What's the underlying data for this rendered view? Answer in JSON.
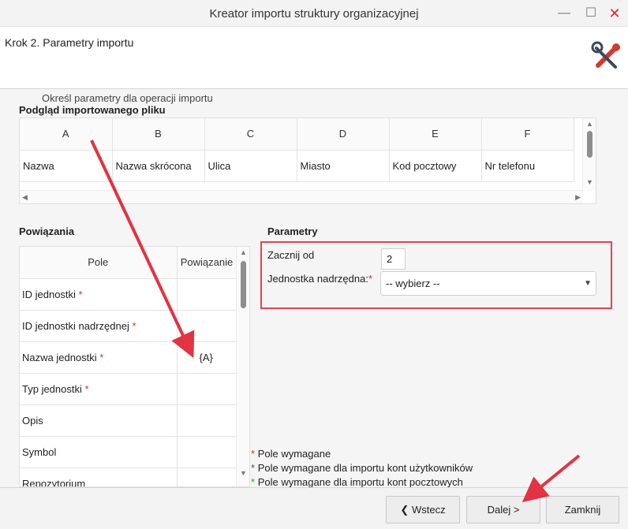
{
  "window": {
    "title": "Kreator importu struktury organizacyjnej",
    "min_glyph": "—",
    "max_glyph": "☐",
    "close_glyph": "✕"
  },
  "header": {
    "step_title": "Krok 2. Parametry importu",
    "icon": "tools-icon"
  },
  "content": {
    "subtitle": "Określ parametry dla operacji importu",
    "preview": {
      "title": "Podgląd importowanego pliku",
      "columns": [
        "A",
        "B",
        "C",
        "D",
        "E",
        "F"
      ],
      "row": [
        "Nazwa",
        "Nazwa skrócona",
        "Ulica",
        "Miasto",
        "Kod pocztowy",
        "Nr telefonu"
      ]
    },
    "mapping": {
      "title": "Powiązania",
      "headers": [
        "Pole",
        "Powiązanie"
      ],
      "rows": [
        {
          "field": "ID jednostki",
          "required": "*",
          "link": ""
        },
        {
          "field": "ID jednostki nadrzędnej",
          "required": "*",
          "link": ""
        },
        {
          "field": "Nazwa jednostki",
          "required": "*",
          "link": "{A}"
        },
        {
          "field": "Typ jednostki",
          "required": "*",
          "link": ""
        },
        {
          "field": "Opis",
          "required": "",
          "link": ""
        },
        {
          "field": "Symbol",
          "required": "",
          "link": ""
        },
        {
          "field": "Repozytorium",
          "required": "",
          "link": ""
        }
      ]
    },
    "params": {
      "title": "Parametry",
      "start_label": "Zacznij od",
      "start_value": "2",
      "parent_label": "Jednostka nadrzędna:",
      "parent_required": "*",
      "parent_value": "-- wybierz --"
    },
    "legend": [
      {
        "star": "*",
        "text": "Pole wymagane"
      },
      {
        "star": "*",
        "text": "Pole wymagane dla importu kont użytkowników"
      },
      {
        "star": "*",
        "text": "Pole wymagane dla importu kont pocztowych"
      }
    ]
  },
  "footer": {
    "back_label": "Wstecz",
    "back_icon": "chevron-left-icon",
    "next_label": "Dalej >",
    "close_label": "Zamknij"
  },
  "colors": {
    "annotation_red": "#e23344",
    "required_red": "#d32f2f",
    "green_star": "#2e9a3b"
  }
}
